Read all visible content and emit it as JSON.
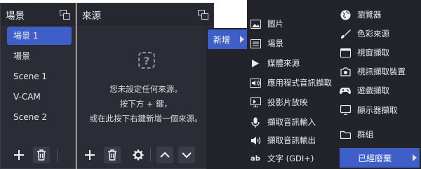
{
  "scenes_dock": {
    "title": "場景",
    "items": [
      "場景 1",
      "場景",
      "Scene 1",
      "V-CAM",
      "Scene 2"
    ],
    "selected_index": 0
  },
  "sources_dock": {
    "title": "來源",
    "empty_lines": [
      "您未設定任何來源。",
      "按下方 + 鍵，",
      "或在此按下右鍵新增一個來源。"
    ]
  },
  "context_menu": {
    "add_label": "新增"
  },
  "add_menu": {
    "left_column": [
      {
        "label": "圖片",
        "icon": "image-icon"
      },
      {
        "label": "場景",
        "icon": "list-icon"
      },
      {
        "label": "媒體來源",
        "icon": "play-icon"
      },
      {
        "label": "應用程式音訊擷取",
        "icon": "speaker-icon"
      },
      {
        "label": "投影片放映",
        "icon": "slideshow-icon"
      },
      {
        "label": "擷取音訊輸入",
        "icon": "microphone-icon"
      },
      {
        "label": "擷取音訊輸出",
        "icon": "speaker-icon"
      },
      {
        "label": "文字 (GDI+)",
        "icon": "text-icon"
      }
    ],
    "right_column": [
      {
        "label": "瀏覽器",
        "icon": "globe-icon"
      },
      {
        "label": "色彩來源",
        "icon": "brush-icon"
      },
      {
        "label": "視窗擷取",
        "icon": "window-icon"
      },
      {
        "label": "視訊擷取裝置",
        "icon": "camera-icon"
      },
      {
        "label": "遊戲擷取",
        "icon": "gamepad-icon"
      },
      {
        "label": "顯示器擷取",
        "icon": "monitor-icon"
      },
      {
        "label": "群組",
        "icon": "folder-icon"
      },
      {
        "label": "已經廢棄",
        "icon": "",
        "highlighted": true
      }
    ]
  },
  "colors": {
    "panel": "#2b2c35",
    "menu": "#22232b",
    "accent": "#3e5fc7"
  }
}
